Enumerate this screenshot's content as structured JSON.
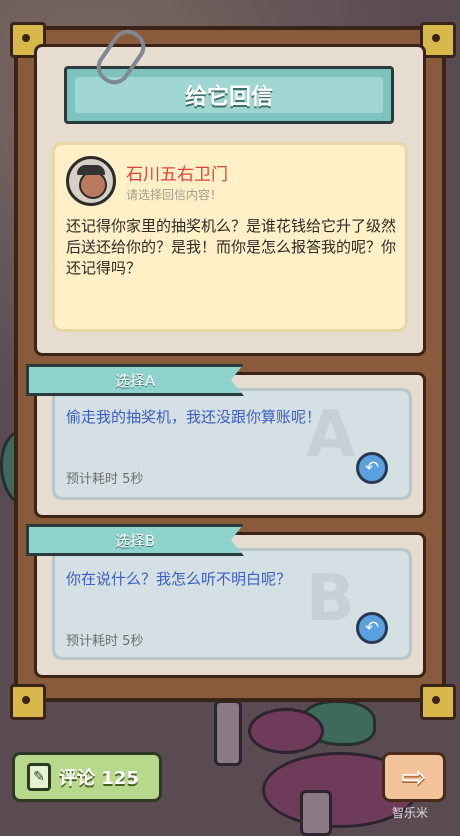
{
  "title": "给它回信",
  "letter": {
    "sender": "石川五右卫门",
    "hint": "请选择回信内容！",
    "message": "还记得你家里的抽奖机么？是谁花钱给它升了级然后送还给你的？是我！而你是怎么报答我的呢？你还记得吗？"
  },
  "options": [
    {
      "label": "选择A",
      "text": "偷走我的抽奖机，我还没跟你算账呢！",
      "time": "预计耗时  5秒",
      "letter": "A"
    },
    {
      "label": "选择B",
      "text": "你在说什么？我怎么听不明白呢？",
      "time": "预计耗时  5秒",
      "letter": "B"
    }
  ],
  "footer": {
    "comment_label": "评论 125",
    "next_icon": "arrow-right-icon",
    "watermark": "智乐米"
  },
  "icons": {
    "reply": "reply-icon",
    "paperclip": "paperclip-icon",
    "comment": "comment-icon"
  }
}
